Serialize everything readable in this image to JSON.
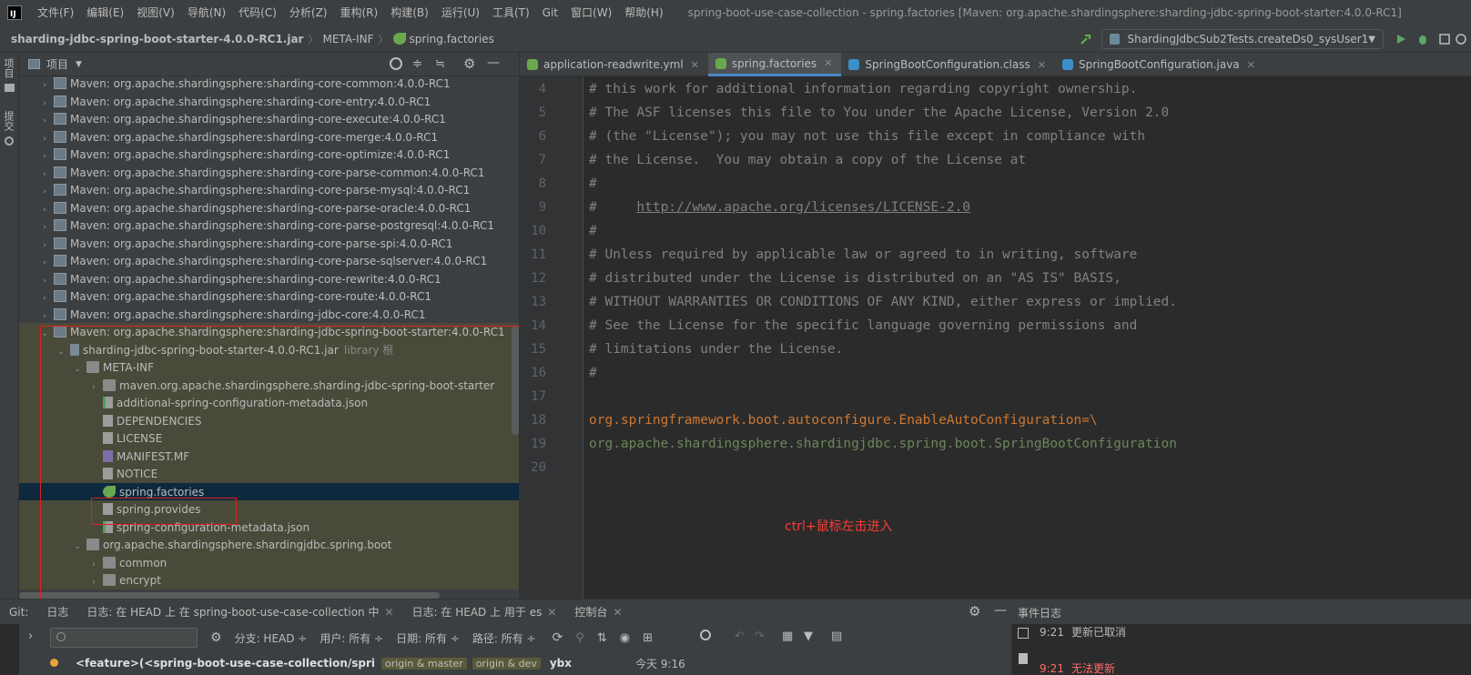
{
  "menu": {
    "items": [
      "文件(F)",
      "编辑(E)",
      "视图(V)",
      "导航(N)",
      "代码(C)",
      "分析(Z)",
      "重构(R)",
      "构建(B)",
      "运行(U)",
      "工具(T)",
      "Git",
      "窗口(W)",
      "帮助(H)"
    ],
    "window_title": "spring-boot-use-case-collection - spring.factories [Maven: org.apache.shardingsphere:sharding-jdbc-spring-boot-starter:4.0.0-RC1]"
  },
  "navbar": {
    "breadcrumbs": [
      "sharding-jdbc-spring-boot-starter-4.0.0-RC1.jar",
      "META-INF",
      "spring.factories"
    ],
    "run_config": "ShardingJdbcSub2Tests.createDs0_sysUser1"
  },
  "left_stripe": {
    "project_label": "项目",
    "commit_label": "提交"
  },
  "project_panel": {
    "title": "项目",
    "tree": [
      {
        "level": 1,
        "arrow": "›",
        "icon": "maven",
        "label": "Maven: org.apache.shardingsphere:sharding-core-common:4.0.0-RC1"
      },
      {
        "level": 1,
        "arrow": "›",
        "icon": "maven",
        "label": "Maven: org.apache.shardingsphere:sharding-core-entry:4.0.0-RC1"
      },
      {
        "level": 1,
        "arrow": "›",
        "icon": "maven",
        "label": "Maven: org.apache.shardingsphere:sharding-core-execute:4.0.0-RC1"
      },
      {
        "level": 1,
        "arrow": "›",
        "icon": "maven",
        "label": "Maven: org.apache.shardingsphere:sharding-core-merge:4.0.0-RC1"
      },
      {
        "level": 1,
        "arrow": "›",
        "icon": "maven",
        "label": "Maven: org.apache.shardingsphere:sharding-core-optimize:4.0.0-RC1"
      },
      {
        "level": 1,
        "arrow": "›",
        "icon": "maven",
        "label": "Maven: org.apache.shardingsphere:sharding-core-parse-common:4.0.0-RC1"
      },
      {
        "level": 1,
        "arrow": "›",
        "icon": "maven",
        "label": "Maven: org.apache.shardingsphere:sharding-core-parse-mysql:4.0.0-RC1"
      },
      {
        "level": 1,
        "arrow": "›",
        "icon": "maven",
        "label": "Maven: org.apache.shardingsphere:sharding-core-parse-oracle:4.0.0-RC1"
      },
      {
        "level": 1,
        "arrow": "›",
        "icon": "maven",
        "label": "Maven: org.apache.shardingsphere:sharding-core-parse-postgresql:4.0.0-RC1"
      },
      {
        "level": 1,
        "arrow": "›",
        "icon": "maven",
        "label": "Maven: org.apache.shardingsphere:sharding-core-parse-spi:4.0.0-RC1"
      },
      {
        "level": 1,
        "arrow": "›",
        "icon": "maven",
        "label": "Maven: org.apache.shardingsphere:sharding-core-parse-sqlserver:4.0.0-RC1"
      },
      {
        "level": 1,
        "arrow": "›",
        "icon": "maven",
        "label": "Maven: org.apache.shardingsphere:sharding-core-rewrite:4.0.0-RC1"
      },
      {
        "level": 1,
        "arrow": "›",
        "icon": "maven",
        "label": "Maven: org.apache.shardingsphere:sharding-core-route:4.0.0-RC1"
      },
      {
        "level": 1,
        "arrow": "›",
        "icon": "maven",
        "label": "Maven: org.apache.shardingsphere:sharding-jdbc-core:4.0.0-RC1"
      },
      {
        "level": 1,
        "arrow": "⌄",
        "icon": "maven",
        "label": "Maven: org.apache.shardingsphere:sharding-jdbc-spring-boot-starter:4.0.0-RC1"
      },
      {
        "level": 2,
        "arrow": "⌄",
        "icon": "jar",
        "label": "sharding-jdbc-spring-boot-starter-4.0.0-RC1.jar",
        "suffix": "library 根"
      },
      {
        "level": 3,
        "arrow": "⌄",
        "icon": "folder",
        "label": "META-INF"
      },
      {
        "level": 4,
        "arrow": "›",
        "icon": "folder",
        "label": "maven.org.apache.shardingsphere.sharding-jdbc-spring-boot-starter"
      },
      {
        "level": 4,
        "arrow": "",
        "icon": "json",
        "label": "additional-spring-configuration-metadata.json"
      },
      {
        "level": 4,
        "arrow": "",
        "icon": "file",
        "label": "DEPENDENCIES"
      },
      {
        "level": 4,
        "arrow": "",
        "icon": "file",
        "label": "LICENSE"
      },
      {
        "level": 4,
        "arrow": "",
        "icon": "mf",
        "label": "MANIFEST.MF"
      },
      {
        "level": 4,
        "arrow": "",
        "icon": "file",
        "label": "NOTICE"
      },
      {
        "level": 4,
        "arrow": "",
        "icon": "spring",
        "label": "spring.factories",
        "selected": true
      },
      {
        "level": 4,
        "arrow": "",
        "icon": "file",
        "label": "spring.provides"
      },
      {
        "level": 4,
        "arrow": "",
        "icon": "json",
        "label": "spring-configuration-metadata.json"
      },
      {
        "level": 3,
        "arrow": "⌄",
        "icon": "folder",
        "label": "org.apache.shardingsphere.shardingjdbc.spring.boot"
      },
      {
        "level": 4,
        "arrow": "›",
        "icon": "folder",
        "label": "common"
      },
      {
        "level": 4,
        "arrow": "›",
        "icon": "folder",
        "label": "encrypt"
      }
    ]
  },
  "editor": {
    "tabs": [
      {
        "label": "application-readwrite.yml",
        "color": "#6aa84f",
        "active": false
      },
      {
        "label": "spring.factories",
        "color": "#6aa84f",
        "active": true
      },
      {
        "label": "SpringBootConfiguration.class",
        "color": "#3d8fc9",
        "active": false
      },
      {
        "label": "SpringBootConfiguration.java",
        "color": "#3d8fc9",
        "active": false
      }
    ],
    "lines": [
      {
        "no": "4",
        "text": "# this work for additional information regarding copyright ownership."
      },
      {
        "no": "5",
        "text": "# The ASF licenses this file to You under the Apache License, Version 2.0"
      },
      {
        "no": "6",
        "text": "# (the \"License\"); you may not use this file except in compliance with"
      },
      {
        "no": "7",
        "text": "# the License.  You may obtain a copy of the License at"
      },
      {
        "no": "8",
        "text": "#"
      },
      {
        "no": "9",
        "text": "#     ",
        "link": "http://www.apache.org/licenses/LICENSE-2.0"
      },
      {
        "no": "10",
        "text": "#"
      },
      {
        "no": "11",
        "text": "# Unless required by applicable law or agreed to in writing, software"
      },
      {
        "no": "12",
        "text": "# distributed under the License is distributed on an \"AS IS\" BASIS,"
      },
      {
        "no": "13",
        "text": "# WITHOUT WARRANTIES OR CONDITIONS OF ANY KIND, either express or implied."
      },
      {
        "no": "14",
        "text": "# See the License for the specific language governing permissions and"
      },
      {
        "no": "15",
        "text": "# limitations under the License."
      },
      {
        "no": "16",
        "text": "#"
      },
      {
        "no": "17",
        "text": ""
      },
      {
        "no": "18",
        "key": "org.springframework.boot.autoconfigure.EnableAutoConfiguration=\\"
      },
      {
        "no": "19",
        "value": "org.apache.shardingsphere.shardingjdbc.spring.boot.SpringBootConfiguration"
      },
      {
        "no": "20",
        "text": ""
      }
    ],
    "annotation": "ctrl+鼠标左击进入"
  },
  "bottom": {
    "tabs": [
      {
        "label": "Git:",
        "close": false
      },
      {
        "label": "日志",
        "close": false
      },
      {
        "label": "日志: 在 HEAD 上 在 spring-boot-use-case-collection 中",
        "close": true
      },
      {
        "label": "日志: 在 HEAD 上 用于 es",
        "close": true
      },
      {
        "label": "控制台",
        "close": true
      }
    ],
    "event_log_title": "事件日志",
    "filters": [
      "分支: HEAD ÷",
      "用户: 所有 ÷",
      "日期: 所有 ÷",
      "路径: 所有 ÷"
    ],
    "commit": {
      "message": "<feature>(<spring-boot-use-case-collection/spring-bo",
      "refs": [
        "origin & master",
        "origin & dev"
      ],
      "author": "ybx",
      "date": "今天 9:16"
    },
    "events": [
      {
        "time": "9:21",
        "text": "更新已取消",
        "error": false
      },
      {
        "time": "9:21",
        "text": "无法更新",
        "error": true
      }
    ]
  }
}
